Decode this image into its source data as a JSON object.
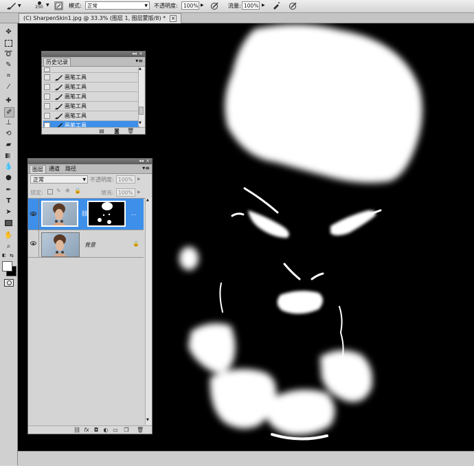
{
  "options_bar": {
    "brush_size": "250",
    "mode_label": "模式:",
    "mode_value": "正常",
    "opacity_label": "不透明度:",
    "opacity_value": "100%",
    "flow_label": "流量:",
    "flow_value": "100%"
  },
  "document": {
    "tab_title": "(C) SharpenSkin1.jpg @ 33.3% (图层 1, 图层蒙版/8) *",
    "close_glyph": "×"
  },
  "history_panel": {
    "title": "历史记录",
    "items": [
      "画笔工具",
      "画笔工具",
      "画笔工具",
      "画笔工具",
      "画笔工具",
      "画笔工具"
    ],
    "selected_index": 5
  },
  "layers_panel": {
    "tabs": [
      "图层",
      "通道",
      "路径"
    ],
    "blend_mode": "正常",
    "opacity_label": "不透明度:",
    "opacity_value": "100%",
    "lock_label": "锁定:",
    "fill_label": "填充:",
    "fill_value": "100%",
    "layers": [
      {
        "name": "",
        "has_mask": true,
        "selected": true
      },
      {
        "name": "背景",
        "has_mask": false,
        "selected": false
      }
    ],
    "selected_layer_dots": "..."
  },
  "colors": {
    "selection_blue": "#3d8fe9",
    "canvas_bg": "#000000",
    "mask_white": "#ffffff",
    "panel_bg": "#d8d8d8"
  }
}
